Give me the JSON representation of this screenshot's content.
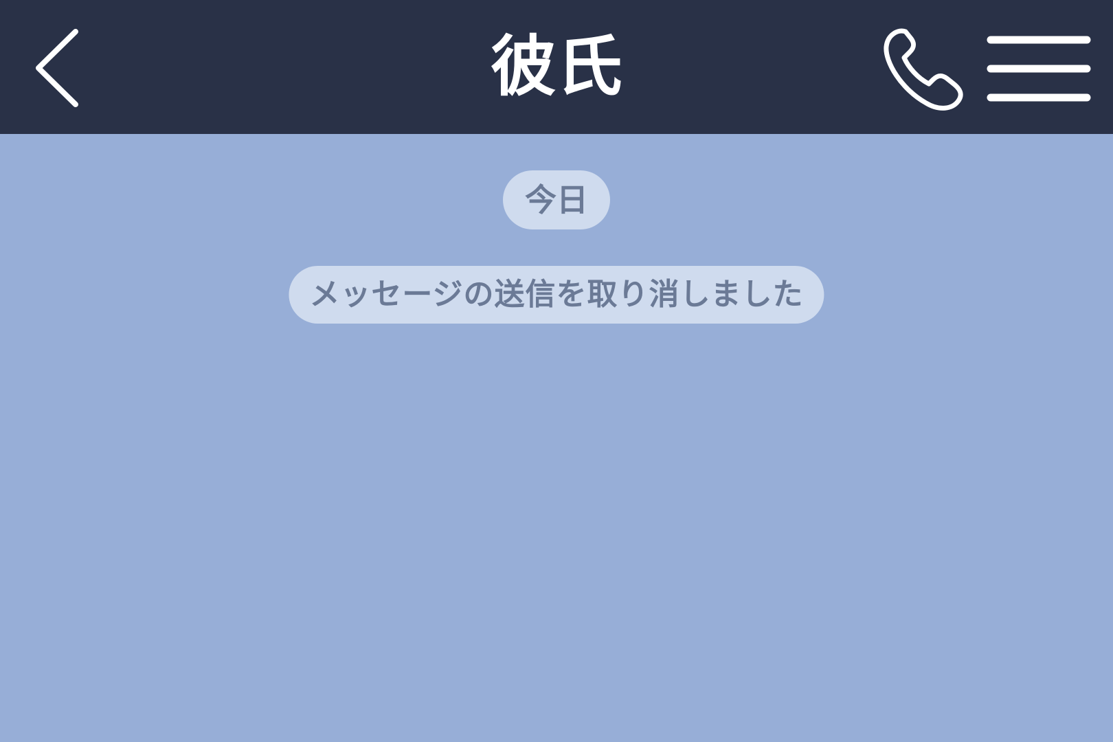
{
  "colors": {
    "header_bg": "#293147",
    "chat_bg": "#97aed7",
    "pill_bg": "#cfdbee",
    "pill_text": "#6b7a96",
    "icon": "#ffffff"
  },
  "header": {
    "title": "彼氏",
    "back_icon": "chevron-left-icon",
    "call_icon": "phone-icon",
    "menu_icon": "hamburger-menu-icon"
  },
  "chat": {
    "date_label": "今日",
    "system_message": "メッセージの送信を取り消しました"
  }
}
